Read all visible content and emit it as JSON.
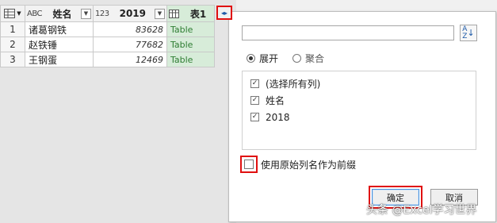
{
  "grid": {
    "columns": [
      {
        "type_label": "ABC",
        "name": "姓名"
      },
      {
        "type_label": "123",
        "name": "2019"
      },
      {
        "name": "表1"
      }
    ],
    "rows": [
      {
        "num": "1",
        "name": "诸葛钢铁",
        "value": "83628",
        "table": "Table"
      },
      {
        "num": "2",
        "name": "赵铁锤",
        "value": "77682",
        "table": "Table"
      },
      {
        "num": "3",
        "name": "王钢蛋",
        "value": "12469",
        "table": "Table"
      }
    ]
  },
  "panel": {
    "search_value": "",
    "radio_expand": "展开",
    "radio_aggregate": "聚合",
    "columns_list": [
      "(选择所有列)",
      "姓名",
      "2018"
    ],
    "prefix_label": "使用原始列名作为前缀",
    "ok_label": "确定",
    "cancel_label": "取消"
  },
  "watermark": "头条 @Excel学习世界",
  "colors": {
    "highlight": "#e01010",
    "table_cell_bg": "#d7ecd9",
    "table_cell_text": "#2e7d32"
  }
}
